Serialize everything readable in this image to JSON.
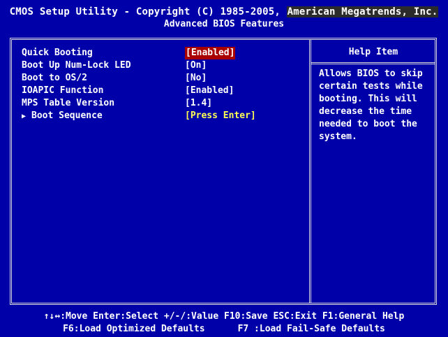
{
  "header": {
    "line1_prefix": "CMOS",
    "line1_rest": "Setup Utility - Copyright (C) 1985-2005,",
    "line1_company": "American Megatrends, Inc.",
    "page_title": "Advanced BIOS Features"
  },
  "items": [
    {
      "label": "Quick Booting",
      "value": "[Enabled]",
      "state": "selected"
    },
    {
      "label": "Boot Up Num-Lock LED",
      "value": "[On]",
      "state": "normal"
    },
    {
      "label": "Boot to OS/2",
      "value": "[No]",
      "state": "normal"
    },
    {
      "label": "IOAPIC Function",
      "value": "[Enabled]",
      "state": "normal"
    },
    {
      "label": "MPS Table Version",
      "value": "[1.4]",
      "state": "normal"
    },
    {
      "label": "Boot Sequence",
      "value": "[Press Enter]",
      "state": "submenu"
    }
  ],
  "help": {
    "title": "Help Item",
    "text": "Allows BIOS to skip\ncertain tests while\nbooting. This will\ndecrease the time\nneeded to boot the\nsystem."
  },
  "footer": {
    "line1": "↑↓↔:Move  Enter:Select  +/-/:Value  F10:Save  ESC:Exit  F1:General Help",
    "line2_left": "F6:Load Optimized Defaults",
    "line2_right": "F7 :Load Fail-Safe Defaults"
  },
  "colors": {
    "background": "#0000a8",
    "selected": "#a80000",
    "submenu_value": "#ffff54",
    "border": "#d7d7d7"
  }
}
